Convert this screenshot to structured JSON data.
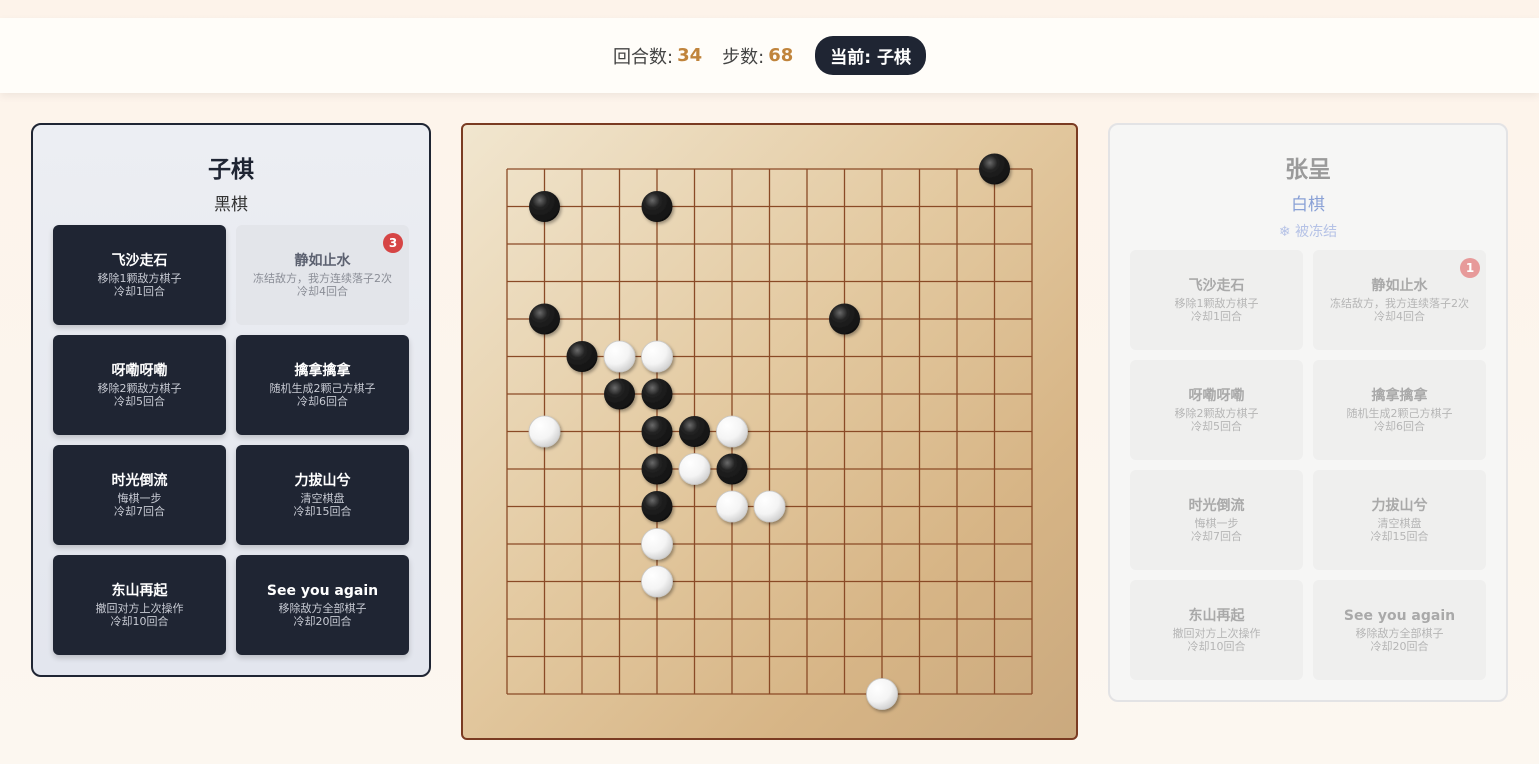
{
  "topbar": {
    "rounds_label": "回合数:",
    "rounds_value": "34",
    "steps_label": "步数:",
    "steps_value": "68",
    "current": "当前: 子棋"
  },
  "left_player": {
    "name": "子棋",
    "color_label": "黑棋",
    "skills": [
      {
        "title": "飞沙走石",
        "desc": "移除1颗敌方棋子",
        "cooldown": "冷却1回合",
        "state": "ready"
      },
      {
        "title": "静如止水",
        "desc": "冻结敌方，我方连续落子2次",
        "cooldown": "冷却4回合",
        "state": "cooling",
        "badge": "3"
      },
      {
        "title": "呀嘞呀嘞",
        "desc": "移除2颗敌方棋子",
        "cooldown": "冷却5回合",
        "state": "ready"
      },
      {
        "title": "擒拿擒拿",
        "desc": "随机生成2颗己方棋子",
        "cooldown": "冷却6回合",
        "state": "ready"
      },
      {
        "title": "时光倒流",
        "desc": "悔棋一步",
        "cooldown": "冷却7回合",
        "state": "ready"
      },
      {
        "title": "力拔山兮",
        "desc": "清空棋盘",
        "cooldown": "冷却15回合",
        "state": "ready"
      },
      {
        "title": "东山再起",
        "desc": "撤回对方上次操作",
        "cooldown": "冷却10回合",
        "state": "ready"
      },
      {
        "title": "See you again",
        "desc": "移除敌方全部棋子",
        "cooldown": "冷却20回合",
        "state": "ready"
      }
    ]
  },
  "right_player": {
    "name": "张呈",
    "color_label": "白棋",
    "status": "被冻结",
    "status_icon": "snowflake-icon",
    "skills": [
      {
        "title": "飞沙走石",
        "desc": "移除1颗敌方棋子",
        "cooldown": "冷却1回合",
        "state": "frozen"
      },
      {
        "title": "静如止水",
        "desc": "冻结敌方，我方连续落子2次",
        "cooldown": "冷却4回合",
        "state": "frozen",
        "badge": "1"
      },
      {
        "title": "呀嘞呀嘞",
        "desc": "移除2颗敌方棋子",
        "cooldown": "冷却5回合",
        "state": "frozen"
      },
      {
        "title": "擒拿擒拿",
        "desc": "随机生成2颗己方棋子",
        "cooldown": "冷却6回合",
        "state": "frozen"
      },
      {
        "title": "时光倒流",
        "desc": "悔棋一步",
        "cooldown": "冷却7回合",
        "state": "frozen"
      },
      {
        "title": "力拔山兮",
        "desc": "清空棋盘",
        "cooldown": "冷却15回合",
        "state": "frozen"
      },
      {
        "title": "东山再起",
        "desc": "撤回对方上次操作",
        "cooldown": "冷却10回合",
        "state": "frozen"
      },
      {
        "title": "See you again",
        "desc": "移除敌方全部棋子",
        "cooldown": "冷却20回合",
        "state": "frozen"
      }
    ]
  },
  "board": {
    "size": 15,
    "black_stones": [
      [
        13,
        0
      ],
      [
        1,
        1
      ],
      [
        4,
        1
      ],
      [
        1,
        4
      ],
      [
        9,
        4
      ],
      [
        2,
        5
      ],
      [
        3,
        6
      ],
      [
        4,
        6
      ],
      [
        4,
        7
      ],
      [
        5,
        7
      ],
      [
        4,
        8
      ],
      [
        6,
        8
      ],
      [
        4,
        9
      ]
    ],
    "white_stones": [
      [
        3,
        5
      ],
      [
        4,
        5
      ],
      [
        1,
        7
      ],
      [
        6,
        7
      ],
      [
        5,
        8
      ],
      [
        6,
        9
      ],
      [
        7,
        9
      ],
      [
        4,
        10
      ],
      [
        4,
        11
      ],
      [
        10,
        14
      ]
    ],
    "colors": {
      "black": "#111111",
      "white": "#f4f4f4",
      "line": "#8a4a26"
    }
  }
}
